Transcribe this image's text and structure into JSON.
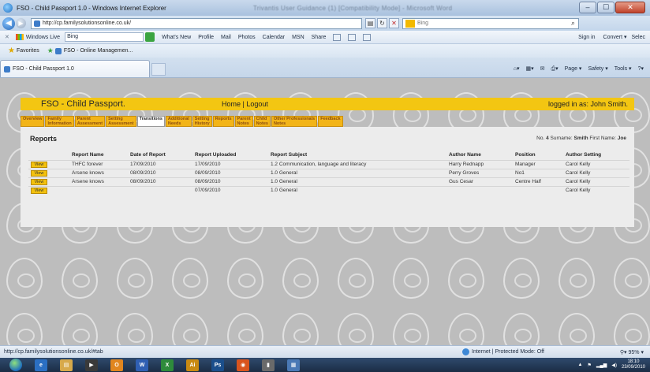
{
  "window": {
    "title": "FSO - Child Passport 1.0 - Windows Internet Explorer",
    "blurred_title": "Trivantis User Guidance (1) [Compatibility Mode] - Microsoft Word",
    "min": "–",
    "max": "☐",
    "close": "✕"
  },
  "address": {
    "url": "http://cp.familysolutionsonline.co.uk/",
    "search_placeholder": "Bing",
    "search_go": "⌕"
  },
  "toolbar": {
    "close": "✕",
    "windows_live": "Windows Live",
    "search_value": "Bing",
    "links": [
      "What's New",
      "Profile",
      "Mail",
      "Photos",
      "Calendar",
      "MSN",
      "Share"
    ],
    "sign_in": "Sign in",
    "convert": "Convert ▾",
    "select": "Selec"
  },
  "favorites": {
    "label": "Favorites",
    "items": [
      "FSO - Online Managemen..."
    ]
  },
  "tabs": {
    "active": "FSO - Child Passport 1.0",
    "commands": [
      "Page ▾",
      "Safety ▾",
      "Tools ▾"
    ]
  },
  "app": {
    "title": "FSO - Child Passport.",
    "nav": "Home | Logout",
    "user": "logged in as: John Smith.",
    "tabs": [
      {
        "line1": "Overview",
        "line2": ""
      },
      {
        "line1": "Family",
        "line2": "Information"
      },
      {
        "line1": "Parent",
        "line2": "Assessment"
      },
      {
        "line1": "Setting",
        "line2": "Assessment"
      },
      {
        "line1": "Transitions",
        "line2": ""
      },
      {
        "line1": "Additional",
        "line2": "Needs"
      },
      {
        "line1": "Setting",
        "line2": "History"
      },
      {
        "line1": "Reports",
        "line2": ""
      },
      {
        "line1": "Parent",
        "line2": "Notes"
      },
      {
        "line1": "Child",
        "line2": "Notes"
      },
      {
        "line1": "Other Professionals",
        "line2": "Notes"
      },
      {
        "line1": "Feedback",
        "line2": ""
      }
    ]
  },
  "reports": {
    "heading": "Reports",
    "pupil": {
      "no_label": "No.",
      "no": "4",
      "surname_label": "Surname:",
      "surname": "Smith",
      "first_label": "First Name:",
      "first": "Joe"
    },
    "columns": [
      "",
      "Report Name",
      "Date of Report",
      "Report Uploaded",
      "Report Subject",
      "Author Name",
      "Position",
      "Author Setting"
    ],
    "view_label": "View",
    "rows": [
      [
        "THFC forever",
        "17/09/2010",
        "17/09/2010",
        "1.2 Communication, language and literacy",
        "Harry Rednapp",
        "Manager",
        "Carol Kelly"
      ],
      [
        "Arsene knows",
        "08/09/2010",
        "08/09/2010",
        "1.0 General",
        "Perry Groves",
        "No1",
        "Carol Kelly"
      ],
      [
        "Arsene knows",
        "08/09/2010",
        "08/09/2010",
        "1.0 General",
        "Gus Cesar",
        "Centre Half",
        "Carol Kelly"
      ],
      [
        "",
        "",
        "07/09/2010",
        "1.0 General",
        "",
        "",
        "Carol Kelly"
      ]
    ]
  },
  "status": {
    "url": "http://cp.familysolutionsonline.co.uk/#tab",
    "zone": "Internet | Protected Mode: Off",
    "zoom": "95%"
  },
  "taskbar": {
    "clock_time": "18:10",
    "clock_date": "23/09/2010"
  }
}
